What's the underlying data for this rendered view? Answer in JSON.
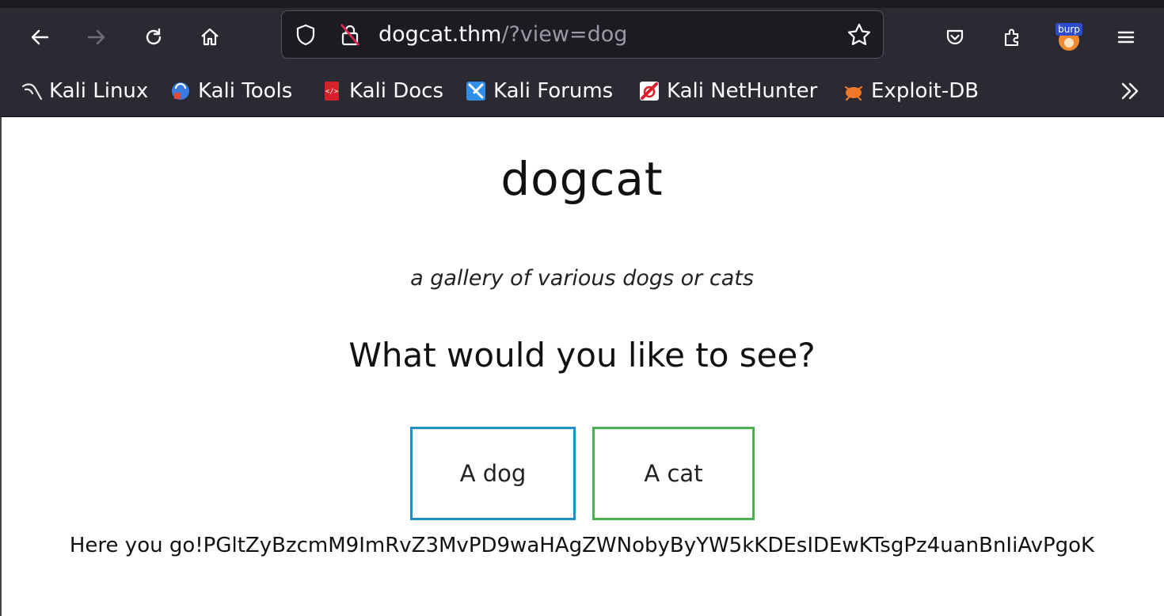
{
  "browser": {
    "url": {
      "host": "dogcat.thm",
      "path": "/?view=dog"
    },
    "bookmarks": [
      {
        "label": "Kali Linux",
        "icon": "kali-dragon-icon"
      },
      {
        "label": "Kali Tools",
        "icon": "kali-tools-icon"
      },
      {
        "label": "Kali Docs",
        "icon": "kali-docs-icon"
      },
      {
        "label": "Kali Forums",
        "icon": "kali-forums-icon"
      },
      {
        "label": "Kali NetHunter",
        "icon": "kali-nethunter-icon"
      },
      {
        "label": "Exploit-DB",
        "icon": "exploit-db-icon"
      }
    ],
    "extension_badge": "burp"
  },
  "page": {
    "title": "dogcat",
    "subtitle": "a gallery of various dogs or cats",
    "question": "What would you like to see?",
    "buttons": {
      "dog": "A dog",
      "cat": "A cat"
    },
    "output": "Here you go!PGltZyBzcmM9ImRvZ3MvPD9waHAgZWNobyByYW5kKDEsIDEwKTsgPz4uanBnIiAvPgoK"
  },
  "colors": {
    "chrome_bg": "#2b2a33",
    "urlbar_bg": "#1c1b22",
    "dog_border": "#1e90c8",
    "cat_border": "#4caf50"
  }
}
